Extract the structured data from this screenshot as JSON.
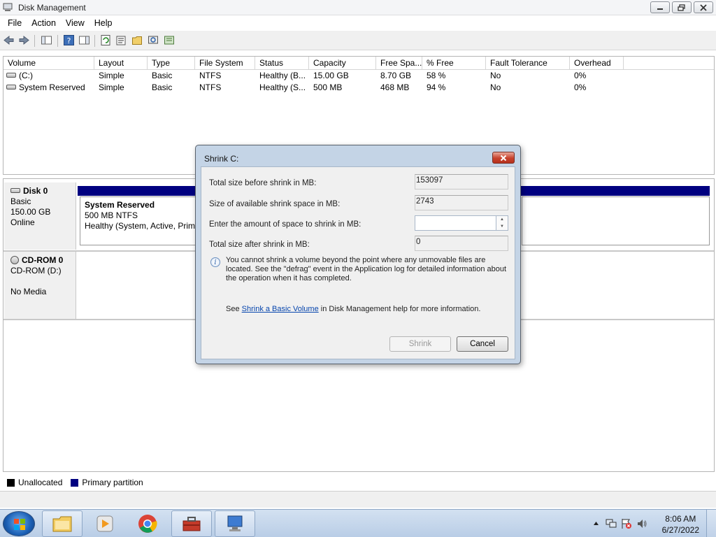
{
  "window": {
    "title": "Disk Management"
  },
  "menu": [
    "File",
    "Action",
    "View",
    "Help"
  ],
  "volumes": {
    "columns": [
      "Volume",
      "Layout",
      "Type",
      "File System",
      "Status",
      "Capacity",
      "Free Spa...",
      "% Free",
      "Fault Tolerance",
      "Overhead"
    ],
    "rows": [
      [
        "(C:)",
        "Simple",
        "Basic",
        "NTFS",
        "Healthy (B...",
        "15.00 GB",
        "8.70 GB",
        "58 %",
        "No",
        "0%"
      ],
      [
        "System Reserved",
        "Simple",
        "Basic",
        "NTFS",
        "Healthy (S...",
        "500 MB",
        "468 MB",
        "94 %",
        "No",
        "0%"
      ]
    ]
  },
  "disks": [
    {
      "name": "Disk 0",
      "line1": "Basic",
      "line2": "150.00 GB",
      "line3": "Online",
      "partition": {
        "name": "System Reserved",
        "line1": "500 MB NTFS",
        "line2": "Healthy (System, Active, Prima"
      }
    },
    {
      "name": "CD-ROM 0",
      "line1": "CD-ROM (D:)",
      "line2": "",
      "line3": "No Media"
    }
  ],
  "legend": [
    {
      "label": "Unallocated",
      "color": "#000000"
    },
    {
      "label": "Primary partition",
      "color": "#000080"
    }
  ],
  "dialog": {
    "title": "Shrink C:",
    "fields": [
      {
        "label": "Total size before shrink in MB:",
        "value": "153097"
      },
      {
        "label": "Size of available shrink space in MB:",
        "value": "2743"
      },
      {
        "label": "Enter the amount of space to shrink in MB:",
        "value": ""
      },
      {
        "label": "Total size after shrink in MB:",
        "value": "0"
      }
    ],
    "info": "You cannot shrink a volume beyond the point where any unmovable files are located. See the \"defrag\" event in the Application log for detailed information about the operation when it has completed.",
    "help_prefix": "See",
    "help_link": "Shrink a Basic Volume",
    "help_suffix": "in Disk Management help for more information.",
    "shrink_label": "Shrink",
    "cancel_label": "Cancel"
  },
  "taskbar": {
    "time": "8:06 AM",
    "date": "6/27/2022"
  }
}
